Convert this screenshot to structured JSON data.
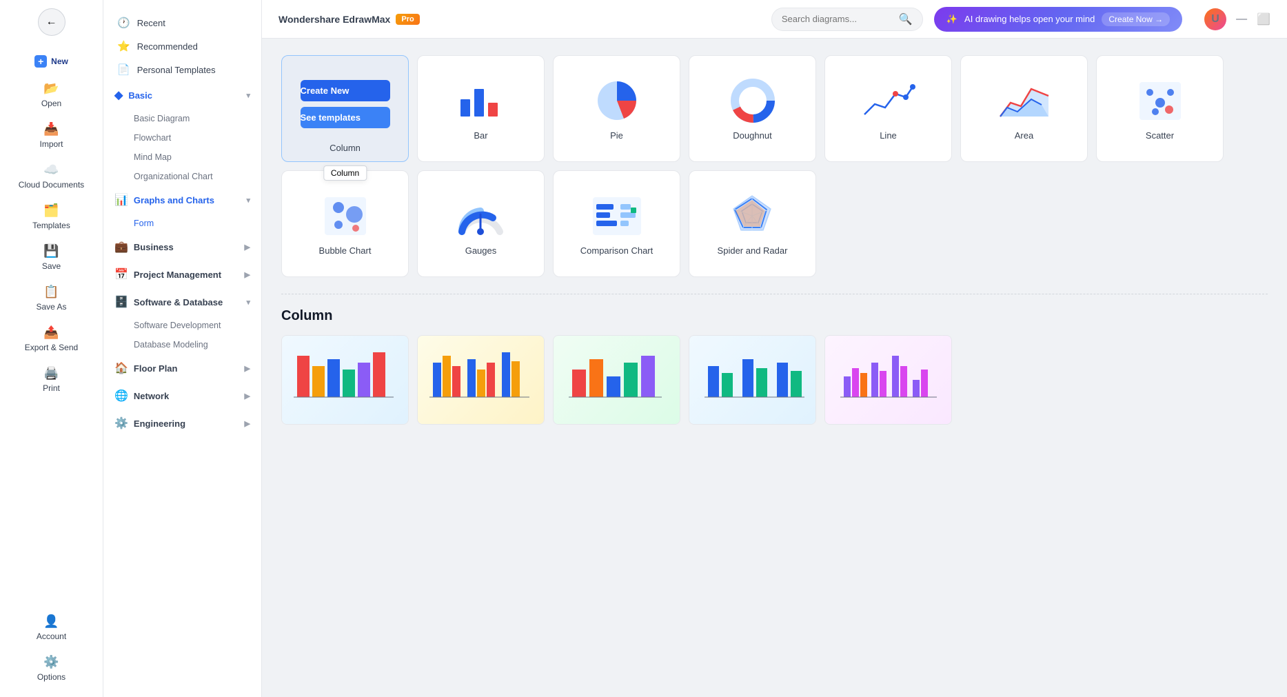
{
  "app": {
    "title": "Wondershare EdrawMax",
    "pro_badge": "Pro",
    "window_title": "Wondershare EdrawMax"
  },
  "header": {
    "search_placeholder": "Search diagrams...",
    "ai_banner_text": "AI drawing helps open your mind",
    "ai_create_label": "Create Now →"
  },
  "sidebar_narrow": {
    "items": [
      {
        "id": "new",
        "label": "New",
        "icon": "📄"
      },
      {
        "id": "open",
        "label": "Open",
        "icon": "📂"
      },
      {
        "id": "import",
        "label": "Import",
        "icon": "📥"
      },
      {
        "id": "cloud",
        "label": "Cloud Documents",
        "icon": "☁️"
      },
      {
        "id": "templates",
        "label": "Templates",
        "icon": "🗂️"
      },
      {
        "id": "save",
        "label": "Save",
        "icon": "💾"
      },
      {
        "id": "saveas",
        "label": "Save As",
        "icon": "📋"
      },
      {
        "id": "export",
        "label": "Export & Send",
        "icon": "📤"
      },
      {
        "id": "print",
        "label": "Print",
        "icon": "🖨️"
      }
    ],
    "bottom_items": [
      {
        "id": "account",
        "label": "Account",
        "icon": "👤"
      },
      {
        "id": "options",
        "label": "Options",
        "icon": "⚙️"
      }
    ]
  },
  "sidebar_wide": {
    "sections": [
      {
        "id": "recent",
        "label": "Recent",
        "icon": "🕐",
        "type": "section"
      },
      {
        "id": "recommended",
        "label": "Recommended",
        "icon": "⭐",
        "type": "section"
      },
      {
        "id": "personal_templates",
        "label": "Personal Templates",
        "icon": "📄",
        "type": "section"
      }
    ],
    "categories": [
      {
        "id": "basic",
        "label": "Basic",
        "icon": "◆",
        "expanded": true,
        "active": false,
        "children": [
          "Basic Diagram",
          "Flowchart",
          "Mind Map",
          "Organizational Chart"
        ]
      },
      {
        "id": "graphs_charts",
        "label": "Graphs and Charts",
        "icon": "📊",
        "expanded": false,
        "active": true,
        "children": [
          "Form"
        ]
      },
      {
        "id": "business",
        "label": "Business",
        "icon": "💼",
        "expanded": false,
        "active": false,
        "children": []
      },
      {
        "id": "project_management",
        "label": "Project Management",
        "icon": "📅",
        "expanded": false,
        "active": false,
        "children": []
      },
      {
        "id": "software_database",
        "label": "Software & Database",
        "icon": "🗄️",
        "expanded": true,
        "active": false,
        "children": [
          "Software Development",
          "Database Modeling"
        ]
      },
      {
        "id": "floor_plan",
        "label": "Floor Plan",
        "icon": "🏠",
        "expanded": false,
        "active": false,
        "children": []
      },
      {
        "id": "network",
        "label": "Network",
        "icon": "🌐",
        "expanded": false,
        "active": false,
        "children": []
      },
      {
        "id": "engineering",
        "label": "Engineering",
        "icon": "⚙️",
        "expanded": false,
        "active": false,
        "children": []
      }
    ]
  },
  "chart_types": [
    {
      "id": "column",
      "label": "Column",
      "selected": true
    },
    {
      "id": "bar",
      "label": "Bar"
    },
    {
      "id": "pie",
      "label": "Pie"
    },
    {
      "id": "doughnut",
      "label": "Doughnut"
    },
    {
      "id": "line",
      "label": "Line"
    },
    {
      "id": "area",
      "label": "Area"
    },
    {
      "id": "scatter",
      "label": "Scatter"
    },
    {
      "id": "bubble",
      "label": "Bubble Chart"
    },
    {
      "id": "gauges",
      "label": "Gauges"
    },
    {
      "id": "comparison",
      "label": "Comparison Chart"
    },
    {
      "id": "spider",
      "label": "Spider and Radar"
    }
  ],
  "buttons": {
    "create_new": "Create New",
    "see_templates": "See templates"
  },
  "tooltip": {
    "column": "Column"
  },
  "section": {
    "title": "Column"
  },
  "templates": [
    {
      "id": "t1"
    },
    {
      "id": "t2"
    },
    {
      "id": "t3"
    },
    {
      "id": "t4"
    },
    {
      "id": "t5"
    }
  ]
}
